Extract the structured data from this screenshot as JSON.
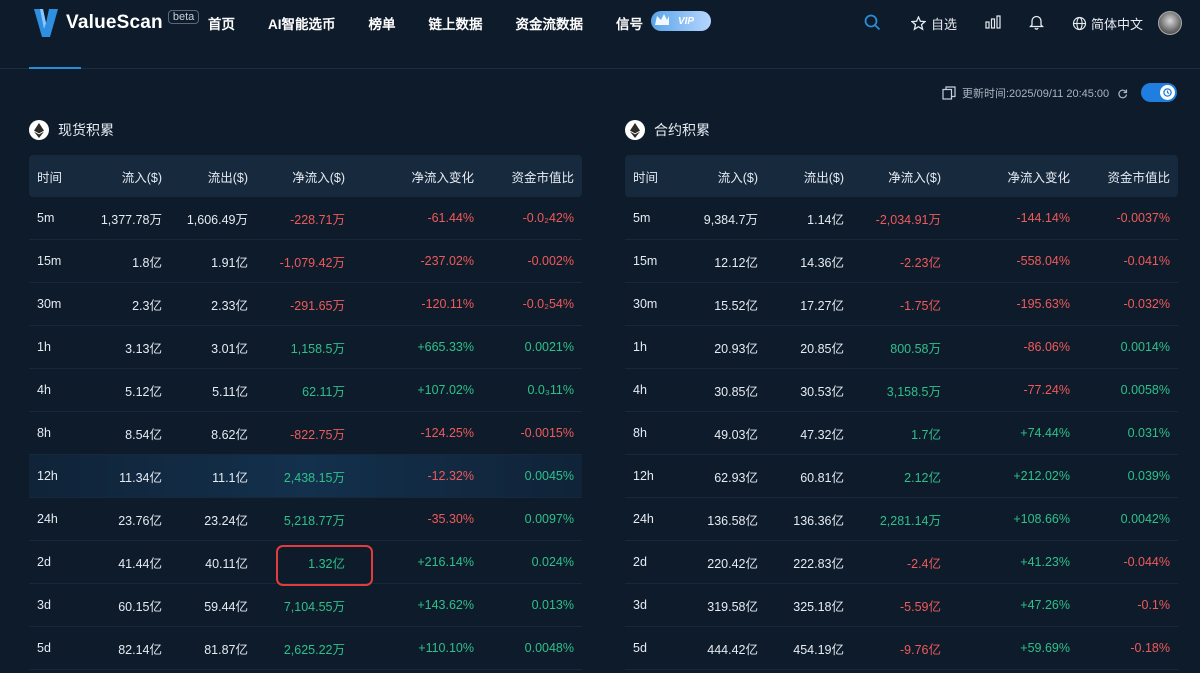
{
  "nav": {
    "brand": "ValueScan",
    "beta": "beta",
    "menu": [
      "首页",
      "AI智能选币",
      "榜单",
      "链上数据",
      "资金流数据",
      "信号"
    ],
    "vip": "VIP",
    "watchlist": "自选",
    "language": "简体中文"
  },
  "update_time": "更新时间:2025/09/11 20:45:00",
  "colors": {
    "positive": "#2fc08a",
    "negative": "#f05a5a",
    "accent": "#1f7ee0",
    "background": "#0d1b2a"
  },
  "spot": {
    "title": "现货积累",
    "headers": [
      "时间",
      "流入($)",
      "流出($)",
      "净流入($)",
      "净流入变化",
      "资金市值比"
    ],
    "rows": [
      [
        "5m",
        "1,377.78万",
        "1,606.49万",
        "-228.71万",
        "-61.44%",
        "-0.0₂42%"
      ],
      [
        "15m",
        "1.8亿",
        "1.91亿",
        "-1,079.42万",
        "-237.02%",
        "-0.002%"
      ],
      [
        "30m",
        "2.3亿",
        "2.33亿",
        "-291.65万",
        "-120.11%",
        "-0.0₂54%"
      ],
      [
        "1h",
        "3.13亿",
        "3.01亿",
        "1,158.5万",
        "+665.33%",
        "0.0021%"
      ],
      [
        "4h",
        "5.12亿",
        "5.11亿",
        "62.11万",
        "+107.02%",
        "0.0₃11%"
      ],
      [
        "8h",
        "8.54亿",
        "8.62亿",
        "-822.75万",
        "-124.25%",
        "-0.0015%"
      ],
      [
        "12h",
        "11.34亿",
        "11.1亿",
        "2,438.15万",
        "-12.32%",
        "0.0045%"
      ],
      [
        "24h",
        "23.76亿",
        "23.24亿",
        "5,218.77万",
        "-35.30%",
        "0.0097%"
      ],
      [
        "2d",
        "41.44亿",
        "40.11亿",
        "1.32亿",
        "+216.14%",
        "0.024%"
      ],
      [
        "3d",
        "60.15亿",
        "59.44亿",
        "7,104.55万",
        "+143.62%",
        "0.013%"
      ],
      [
        "5d",
        "82.14亿",
        "81.87亿",
        "2,625.22万",
        "+110.10%",
        "0.0048%"
      ]
    ],
    "signs": [
      [
        "",
        "",
        "",
        "neg",
        "neg",
        "neg"
      ],
      [
        "",
        "",
        "",
        "neg",
        "neg",
        "neg"
      ],
      [
        "",
        "",
        "",
        "neg",
        "neg",
        "neg"
      ],
      [
        "",
        "",
        "",
        "pos",
        "pos",
        "pos"
      ],
      [
        "",
        "",
        "",
        "pos",
        "pos",
        "pos"
      ],
      [
        "",
        "",
        "",
        "neg",
        "neg",
        "neg"
      ],
      [
        "",
        "",
        "",
        "pos",
        "neg",
        "pos"
      ],
      [
        "",
        "",
        "",
        "pos",
        "neg",
        "pos"
      ],
      [
        "",
        "",
        "",
        "pos",
        "pos",
        "pos"
      ],
      [
        "",
        "",
        "",
        "pos",
        "pos",
        "pos"
      ],
      [
        "",
        "",
        "",
        "pos",
        "pos",
        "pos"
      ]
    ]
  },
  "futures": {
    "title": "合约积累",
    "headers": [
      "时间",
      "流入($)",
      "流出($)",
      "净流入($)",
      "净流入变化",
      "资金市值比"
    ],
    "rows": [
      [
        "5m",
        "9,384.7万",
        "1.14亿",
        "-2,034.91万",
        "-144.14%",
        "-0.0037%"
      ],
      [
        "15m",
        "12.12亿",
        "14.36亿",
        "-2.23亿",
        "-558.04%",
        "-0.041%"
      ],
      [
        "30m",
        "15.52亿",
        "17.27亿",
        "-1.75亿",
        "-195.63%",
        "-0.032%"
      ],
      [
        "1h",
        "20.93亿",
        "20.85亿",
        "800.58万",
        "-86.06%",
        "0.0014%"
      ],
      [
        "4h",
        "30.85亿",
        "30.53亿",
        "3,158.5万",
        "-77.24%",
        "0.0058%"
      ],
      [
        "8h",
        "49.03亿",
        "47.32亿",
        "1.7亿",
        "+74.44%",
        "0.031%"
      ],
      [
        "12h",
        "62.93亿",
        "60.81亿",
        "2.12亿",
        "+212.02%",
        "0.039%"
      ],
      [
        "24h",
        "136.58亿",
        "136.36亿",
        "2,281.14万",
        "+108.66%",
        "0.0042%"
      ],
      [
        "2d",
        "220.42亿",
        "222.83亿",
        "-2.4亿",
        "+41.23%",
        "-0.044%"
      ],
      [
        "3d",
        "319.58亿",
        "325.18亿",
        "-5.59亿",
        "+47.26%",
        "-0.1%"
      ],
      [
        "5d",
        "444.42亿",
        "454.19亿",
        "-9.76亿",
        "+59.69%",
        "-0.18%"
      ]
    ],
    "signs": [
      [
        "",
        "",
        "",
        "neg",
        "neg",
        "neg"
      ],
      [
        "",
        "",
        "",
        "neg",
        "neg",
        "neg"
      ],
      [
        "",
        "",
        "",
        "neg",
        "neg",
        "neg"
      ],
      [
        "",
        "",
        "",
        "pos",
        "neg",
        "pos"
      ],
      [
        "",
        "",
        "",
        "pos",
        "neg",
        "pos"
      ],
      [
        "",
        "",
        "",
        "pos",
        "pos",
        "pos"
      ],
      [
        "",
        "",
        "",
        "pos",
        "pos",
        "pos"
      ],
      [
        "",
        "",
        "",
        "pos",
        "pos",
        "pos"
      ],
      [
        "",
        "",
        "",
        "neg",
        "pos",
        "neg"
      ],
      [
        "",
        "",
        "",
        "neg",
        "pos",
        "neg"
      ],
      [
        "",
        "",
        "",
        "neg",
        "pos",
        "neg"
      ]
    ]
  }
}
